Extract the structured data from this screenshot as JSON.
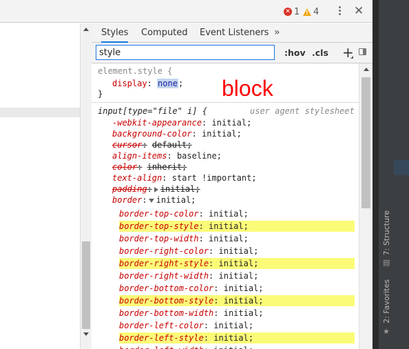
{
  "toolbar": {
    "errors_count": "1",
    "warnings_count": "4",
    "close_glyph": "✕"
  },
  "tabs": [
    {
      "label": "Styles",
      "active": true
    },
    {
      "label": "Computed",
      "active": false
    },
    {
      "label": "Event Listeners",
      "active": false
    }
  ],
  "more_tabs_glyph": "»",
  "filter": {
    "value": "style",
    "hov_label": ":hov",
    "cls_label": ".cls",
    "add_glyph": "+"
  },
  "element_style": {
    "selector": "element.style {",
    "prop": "display",
    "value": "none",
    "close": "}"
  },
  "annotation_text": "block",
  "rule": {
    "selector": "input[type=\"file\" i] {",
    "source": "user agent stylesheet",
    "declarations": [
      {
        "name": "-webkit-appearance",
        "value": "initial;"
      },
      {
        "name": "background-color",
        "value": "initial;"
      },
      {
        "name": "cursor",
        "value": "default;",
        "overridden": true
      },
      {
        "name": "align-items",
        "value": "baseline;"
      },
      {
        "name": "color",
        "value": "inherit;",
        "overridden": true
      },
      {
        "name": "text-align",
        "value": "start !important;"
      },
      {
        "name": "padding",
        "value": "initial;",
        "overridden": true
      },
      {
        "name": "border",
        "value": "initial;"
      }
    ],
    "border_longhands": [
      {
        "name": "border-top-color",
        "value": "initial;"
      },
      {
        "name": "border-top-style",
        "value": "initial;",
        "highlight": true
      },
      {
        "name": "border-top-width",
        "value": "initial;"
      },
      {
        "name": "border-right-color",
        "value": "initial;"
      },
      {
        "name": "border-right-style",
        "value": "initial;",
        "highlight": true
      },
      {
        "name": "border-right-width",
        "value": "initial;"
      },
      {
        "name": "border-bottom-color",
        "value": "initial;"
      },
      {
        "name": "border-bottom-style",
        "value": "initial;",
        "highlight": true
      },
      {
        "name": "border-bottom-width",
        "value": "initial;"
      },
      {
        "name": "border-left-color",
        "value": "initial;"
      },
      {
        "name": "border-left-style",
        "value": "initial;",
        "highlight": true
      },
      {
        "name": "border-left-width",
        "value": "initial;"
      }
    ]
  },
  "side_tools": {
    "structure": "7: Structure",
    "favorites": "2: Favorites"
  },
  "colors": {
    "accent": "#1a73e8",
    "property": "#c80000",
    "highlight": "#fbfb78",
    "annotation": "#ff0000",
    "error": "#d93025",
    "warning": "#f0a500"
  }
}
